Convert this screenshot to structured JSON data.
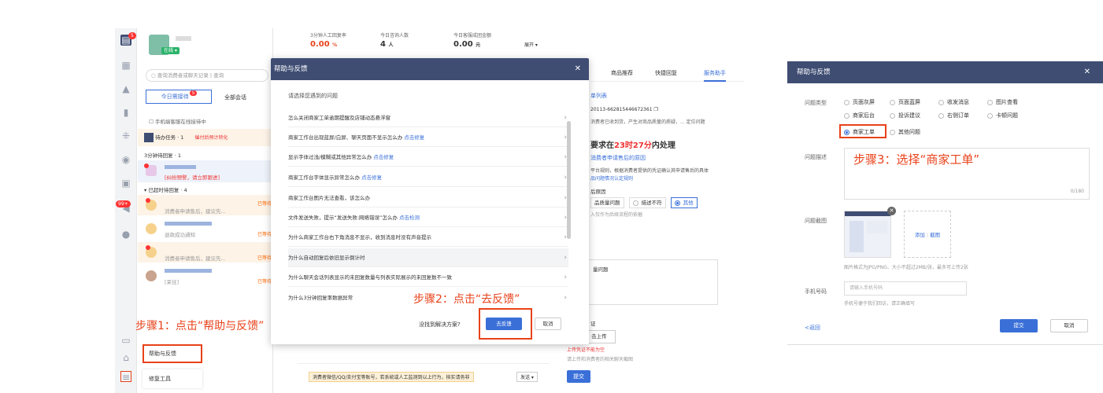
{
  "left_app": {
    "status": "在线",
    "search_placeholder": "查询消费者或聊天记录",
    "search_btn": "查询",
    "tab_today": "今日需接待",
    "tab_today_badge": "5",
    "tab_all": "全部会话",
    "phone_notice": "手机端客服在线接待中",
    "todo": "待办任务 · 1",
    "todo_hint": "催付后预计转化",
    "wait3": "3分钟待回复 · 1",
    "dispute": "[纠纷预警，请立即跟进]",
    "overtime": "已超时待回复 · 4",
    "msg1": "消费者申请售后，建议先...",
    "msg1_tag": "已等待",
    "msg2": "退款成功通知",
    "msg2_tag": "已等待",
    "msg3": "消费者申请售后，建议先...",
    "msg3_tag": "已等待",
    "msg4": "[呆住]",
    "msg4_tag": "已等待",
    "help_feedback": "帮助与反馈",
    "repair": "修复工具",
    "nav_badges": [
      "5",
      "99+"
    ]
  },
  "stats": {
    "s1_label": "3分钟人工回复率",
    "s1_value": "0.00",
    "s1_unit": "%",
    "s2_label": "今日咨询人数",
    "s2_value": "4",
    "s2_unit": "人",
    "s3_label": "今日客服成团金额",
    "s3_value": "0.00",
    "s3_unit": "元",
    "expand": "展开"
  },
  "modal": {
    "title": "帮助与反馈",
    "subtitle": "请选择您遇到的问题",
    "questions": [
      {
        "text": "怎么关闭商家工单逾期提醒及店铺动态悬浮窗",
        "link": ""
      },
      {
        "text": "商家工作台出现蓝屏/白屏、聊天页面不显示怎么办",
        "link": "点击修复"
      },
      {
        "text": "显示字体过浅/模糊或其他异常怎么办",
        "link": "点击修复"
      },
      {
        "text": "商家工作台字体显示异常怎么办",
        "link": "点击修复"
      },
      {
        "text": "商家工作台图片无法查看，该怎么办",
        "link": ""
      },
      {
        "text": "文件发送失败，提示“发送失败:网络错误”怎么办",
        "link": "点击检测"
      },
      {
        "text": "为什么商家工作台右下角消息不显示，收到消息时没有声音提示",
        "link": ""
      },
      {
        "text": "为什么自动回复后依旧显示倒计时",
        "link": ""
      },
      {
        "text": "为什么聊天会话列表显示的未回复数量与列表实际展示的未回复数不一致",
        "link": ""
      },
      {
        "text": "为什么3分钟回复率数据异常",
        "link": ""
      }
    ],
    "footer_q": "没找到解决方案?",
    "feedback_btn": "去反馈",
    "cancel_btn": "取消"
  },
  "steps": {
    "s1": "步骤1：点击“帮助与反馈”",
    "s2": "步骤2：点击“去反馈”",
    "s3": "步骤3：选择“商家工单”"
  },
  "right_panel": {
    "tab1": "商品推荐",
    "tab2": "快捷回复",
    "tab3": "服务助手",
    "list": "单列表",
    "order": "20113-662815446672361",
    "order_desc": "消费者已收到货，产生对商品质量的质疑，...",
    "order_link": "定位问题",
    "deadline_pre": "要求在",
    "deadline_time": "23时27分",
    "deadline_post": "内处理",
    "reason_link": "消费者申请售后的原因",
    "rule_text": "平台规则，根据消费者提供的凭证确认其申请售后的具体",
    "rule_link": "品问题情况认定规则",
    "cause": "后原因",
    "c1": "品质量问题",
    "c2": "描述不符",
    "c3": "其他",
    "note": "入仅作为后续流程的依据",
    "issue": "量问题",
    "cert": "证",
    "upload": "击上传",
    "upload_err": "上传凭证不能为空",
    "upload_hint": "请上传和消费者的相关聊天截图",
    "submit": "提交"
  },
  "bottom_bar": {
    "warn": "消费者微信/QQ/支付宝等账号，若系统或人工监测到以上行为，核实请务非",
    "send": "发送"
  },
  "right_help": {
    "title": "帮助与反馈",
    "type_label": "问题类型",
    "options": [
      "页面灰屏",
      "页面蓝屏",
      "收发消息",
      "图片查看",
      "商家后台",
      "投诉建议",
      "右侧订单",
      "卡顿问题",
      "商家工单",
      "其他问题"
    ],
    "desc_label": "问题描述",
    "counter": "0/180",
    "shot_label": "问题截图",
    "add": "添加",
    "shot": "截图",
    "shot_hint": "图片格式为JPG/PNG、大小不超过2MB/张，最多可上传2张",
    "phone_label": "手机号码",
    "phone_placeholder": "请输入手机号码",
    "phone_hint": "手机号便于我们回访，请正确填写",
    "back": "<返回",
    "submit": "提交",
    "cancel": "取消"
  }
}
